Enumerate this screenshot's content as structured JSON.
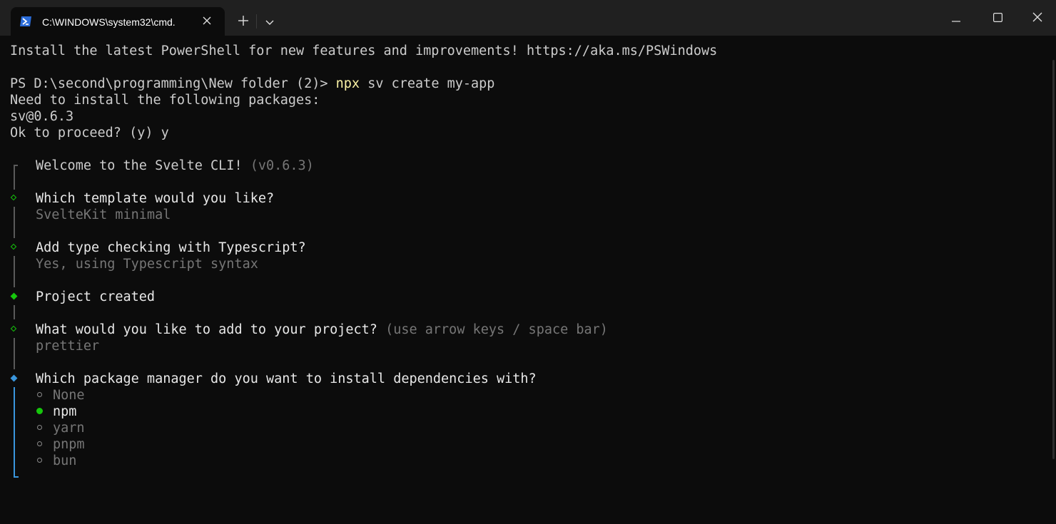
{
  "window": {
    "tab_title": "C:\\WINDOWS\\system32\\cmd.",
    "tab_icon": "powershell-icon",
    "new_tab_icon": "plus-icon",
    "dropdown_icon": "chevron-down-icon",
    "minimize_icon": "minimize-icon",
    "maximize_icon": "maximize-icon",
    "close_icon": "close-icon"
  },
  "terminal": {
    "banner": "Install the latest PowerShell for new features and improvements! https://aka.ms/PSWindows",
    "prompt": "PS D:\\second\\programming\\New folder (2)> ",
    "command_name": "npx",
    "command_args": " sv create my-app",
    "install_notice": "Need to install the following packages:",
    "package": "sv@0.6.3",
    "proceed": "Ok to proceed? (y) y",
    "welcome": "Welcome to the Svelte CLI! ",
    "version": "(v0.6.3)",
    "q_template": "Which template would you like?",
    "a_template": "SvelteKit minimal",
    "q_typescript": "Add type checking with Typescript?",
    "a_typescript": "Yes, using Typescript syntax",
    "project_created": "Project created",
    "q_addons": "What would you like to add to your project? ",
    "q_addons_hint": "(use arrow keys / space bar)",
    "a_addons": "prettier",
    "q_package_manager": "Which package manager do you want to install dependencies with?",
    "pm_options": [
      "None",
      "npm",
      "yarn",
      "pnpm",
      "bun"
    ],
    "pm_selected": "npm"
  },
  "colors": {
    "background": "#0c0c0c",
    "titlebar": "#202020",
    "text": "#cccccc",
    "dim": "#767676",
    "command": "#f9f1a5",
    "green": "#16c60c",
    "blue": "#3a96dd"
  }
}
